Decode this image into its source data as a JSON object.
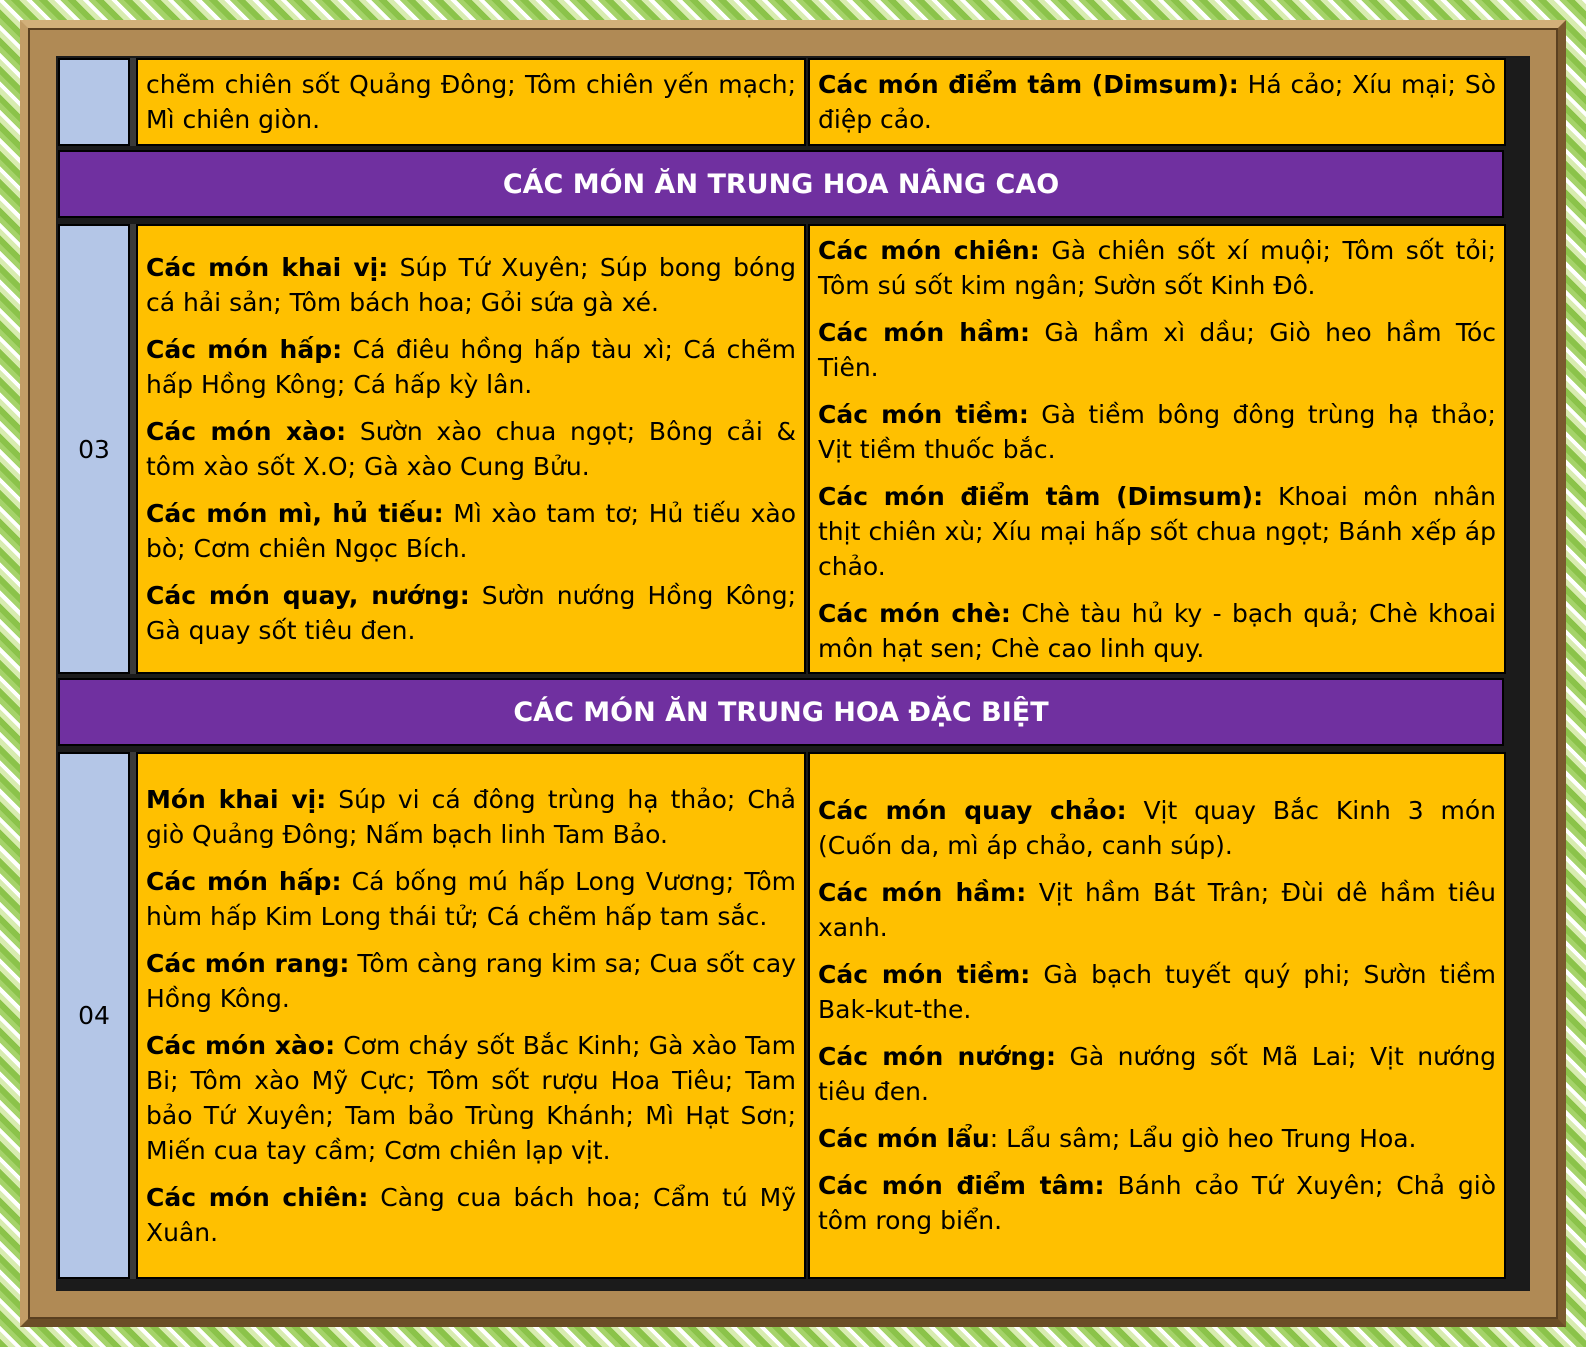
{
  "row_top": {
    "left_text": "chẽm chiên sốt Quảng Đông; Tôm chiên yến mạch; Mì chiên giòn.",
    "right": {
      "label": "Các món điểm tâm (Dimsum):",
      "text": " Há cảo; Xíu mại; Sò điệp cảo."
    }
  },
  "banner_advanced": "CÁC MÓN ĂN TRUNG HOA NÂNG CAO",
  "row_03": {
    "number": "03",
    "left": [
      {
        "label": "Các món khai vị:",
        "text": " Súp Tứ Xuyên; Súp bong bóng cá hải sản; Tôm bách hoa; Gỏi sứa gà xé."
      },
      {
        "label": "Các món hấp:",
        "text": " Cá điêu hồng hấp tàu xì; Cá chẽm hấp Hồng Kông; Cá hấp kỳ lân."
      },
      {
        "label": "Các món xào:",
        "text": " Sườn xào chua ngọt; Bông cải & tôm xào sốt X.O; Gà xào Cung Bửu."
      },
      {
        "label": "Các món mì, hủ tiếu:",
        "text": " Mì xào tam tơ; Hủ tiếu xào bò; Cơm chiên Ngọc Bích."
      },
      {
        "label": "Các món quay, nướng:",
        "text": " Sườn nướng Hồng Kông; Gà quay sốt tiêu đen."
      }
    ],
    "right": [
      {
        "label": "Các món chiên:",
        "text": " Gà chiên sốt xí muội; Tôm sốt tỏi; Tôm sú sốt kim ngân; Sườn sốt Kinh Đô."
      },
      {
        "label": "Các món hầm:",
        "text": " Gà hầm xì dầu; Giò heo hầm Tóc Tiên."
      },
      {
        "label": "Các món tiềm:",
        "text": " Gà tiềm bông đông trùng hạ thảo; Vịt tiềm thuốc bắc."
      },
      {
        "label": "Các món điểm tâm (Dimsum):",
        "text": " Khoai môn nhân thịt chiên xù; Xíu mại hấp sốt chua ngọt; Bánh xếp áp chảo."
      },
      {
        "label": "Các món chè:",
        "text": " Chè tàu hủ ky - bạch quả; Chè khoai môn hạt sen; Chè cao linh quy."
      }
    ]
  },
  "banner_special": "CÁC MÓN ĂN TRUNG HOA ĐẶC BIỆT",
  "row_04": {
    "number": "04",
    "left": [
      {
        "label": "Món khai vị:",
        "text": " Súp vi cá đông trùng hạ thảo; Chả giò Quảng Đông; Nấm bạch linh Tam Bảo."
      },
      {
        "label": "Các món hấp:",
        "text": " Cá bống mú hấp Long Vương; Tôm hùm hấp Kim Long thái tử; Cá chẽm hấp tam sắc."
      },
      {
        "label": "Các món rang:",
        "text": " Tôm càng rang kim sa; Cua sốt cay Hồng Kông."
      },
      {
        "label": "Các món xào:",
        "text": " Cơm cháy sốt Bắc Kinh; Gà xào Tam Bi; Tôm xào Mỹ Cực; Tôm sốt rượu Hoa Tiêu; Tam bảo Tứ Xuyên; Tam bảo Trùng Khánh; Mì Hạt Sơn; Miến cua tay cầm; Cơm chiên lạp vịt."
      },
      {
        "label": "Các món chiên:",
        "text": " Càng cua bách hoa; Cẩm tú Mỹ Xuân."
      }
    ],
    "right": [
      {
        "label": "Các món quay chảo:",
        "text": " Vịt quay Bắc Kinh 3 món (Cuốn da, mì áp chảo, canh súp)."
      },
      {
        "label": "Các món hầm:",
        "text": " Vịt hầm Bát Trân; Đùi dê hầm tiêu xanh."
      },
      {
        "label": "Các món tiềm:",
        "text": " Gà bạch tuyết quý phi; Sườn tiềm Bak-kut-the."
      },
      {
        "label": "Các món nướng:",
        "text": " Gà nướng sốt Mã Lai; Vịt nướng tiêu đen."
      },
      {
        "label": "Các món lẩu",
        "text": ": Lẩu sâm; Lẩu giò heo Trung Hoa."
      },
      {
        "label": "Các món điểm tâm:",
        "text": " Bánh cảo Tứ Xuyên; Chả giò tôm rong biển."
      }
    ]
  }
}
